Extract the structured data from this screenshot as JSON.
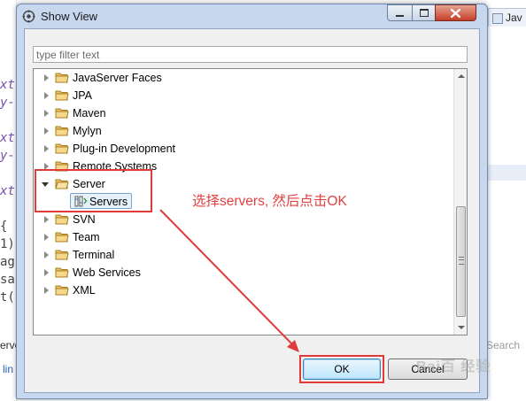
{
  "window": {
    "title": "Show View",
    "background_tab": "Jav",
    "background_search": "Search",
    "background_link": "lin",
    "background_left_text": "erve"
  },
  "filter": {
    "placeholder": "type filter text",
    "value": ""
  },
  "tree": {
    "items": [
      {
        "label": "JavaServer Faces",
        "expanded": false
      },
      {
        "label": "JPA",
        "expanded": false
      },
      {
        "label": "Maven",
        "expanded": false
      },
      {
        "label": "Mylyn",
        "expanded": false
      },
      {
        "label": "Plug-in Development",
        "expanded": false
      },
      {
        "label": "Remote Systems",
        "expanded": false
      },
      {
        "label": "Server",
        "expanded": true,
        "children": [
          {
            "label": "Servers",
            "selected": true
          }
        ]
      },
      {
        "label": "SVN",
        "expanded": false
      },
      {
        "label": "Team",
        "expanded": false
      },
      {
        "label": "Terminal",
        "expanded": false
      },
      {
        "label": "Web Services",
        "expanded": false
      },
      {
        "label": "XML",
        "expanded": false
      }
    ]
  },
  "annotation": {
    "text": "选择servers, 然后点击OK",
    "color": "#e34040"
  },
  "buttons": {
    "ok": "OK",
    "cancel": "Cancel"
  },
  "watermark": "Bai百 经验",
  "colors": {
    "accent_red": "#e03a3a",
    "title_bar": "#c7d8ee",
    "selection": "#e5f1fb"
  }
}
